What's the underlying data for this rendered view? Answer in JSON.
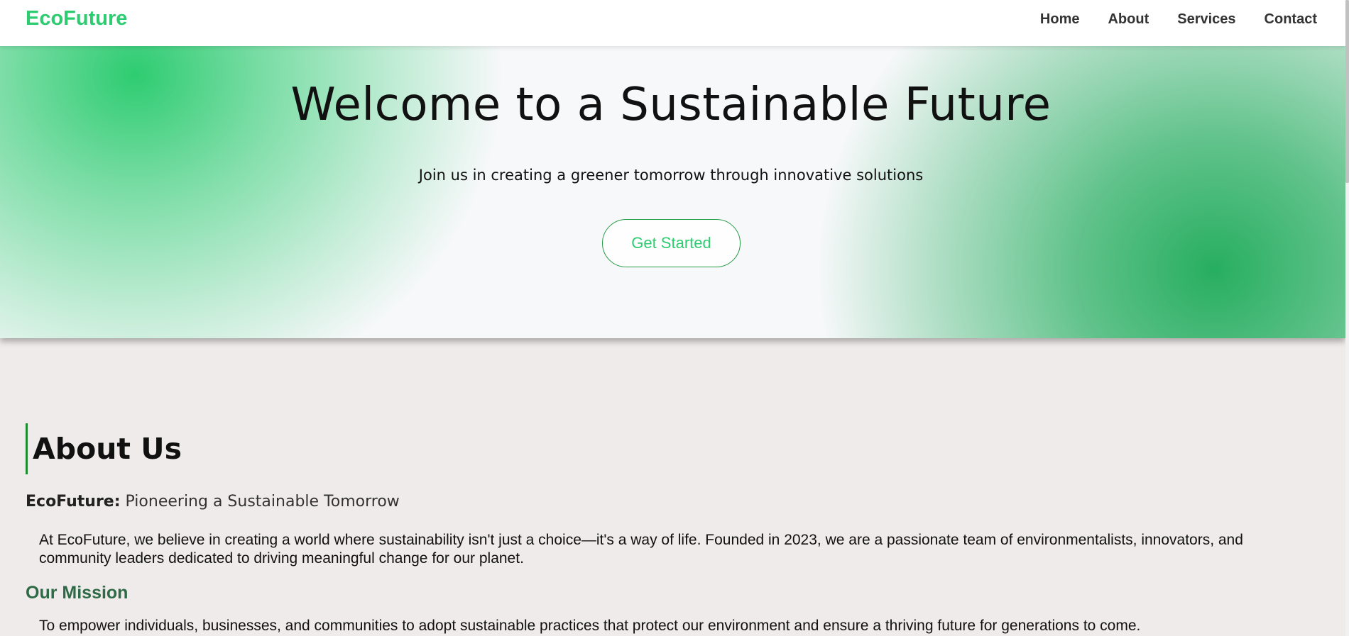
{
  "header": {
    "logo": "EcoFuture",
    "nav": [
      {
        "label": "Home"
      },
      {
        "label": "About"
      },
      {
        "label": "Services"
      },
      {
        "label": "Contact"
      }
    ]
  },
  "hero": {
    "title": "Welcome to a Sustainable Future",
    "subtitle": "Join us in creating a greener tomorrow through innovative solutions",
    "cta_label": "Get Started"
  },
  "about": {
    "heading": "About Us",
    "tagline_brand": "EcoFuture:",
    "tagline_text": " Pioneering a Sustainable Tomorrow",
    "paragraph": "At EcoFuture, we believe in creating a world where sustainability isn't just a choice—it's a way of life. Founded in 2023, we are a passionate team of environmentalists, innovators, and community leaders dedicated to driving meaningful change for our planet.",
    "mission_heading": "Our Mission",
    "mission_text": "To empower individuals, businesses, and communities to adopt sustainable practices that protect our environment and ensure a thriving future for generations to come."
  },
  "colors": {
    "accent": "#2ecc71",
    "accent_dark": "#27ae60",
    "mission_heading": "#2d6a45",
    "background": "#efebea"
  }
}
